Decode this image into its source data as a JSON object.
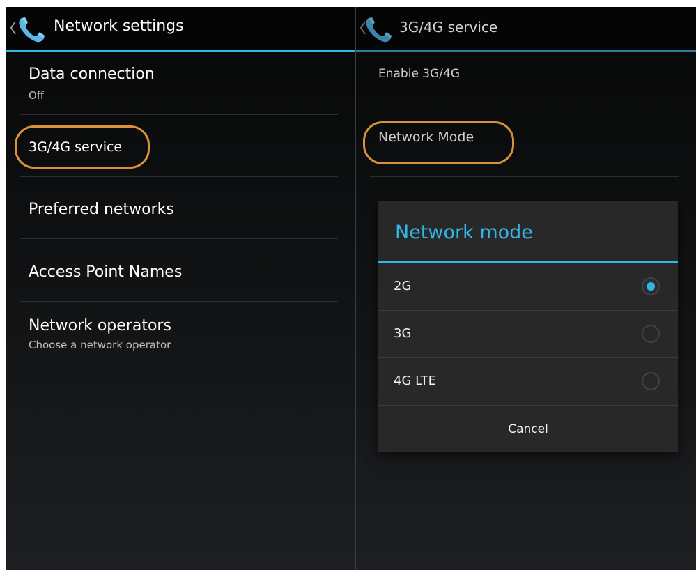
{
  "left": {
    "title": "Network settings",
    "items": [
      {
        "label": "Data connection",
        "sub": "Off"
      },
      {
        "label": "3G/4G service",
        "sub": ""
      },
      {
        "label": "Preferred networks",
        "sub": ""
      },
      {
        "label": "Access Point Names",
        "sub": ""
      },
      {
        "label": "Network operators",
        "sub": "Choose a network operator"
      }
    ]
  },
  "right": {
    "title": "3G/4G service",
    "items": [
      {
        "label": "Enable 3G/4G"
      },
      {
        "label": "Network Mode"
      }
    ]
  },
  "dialog": {
    "title": "Network mode",
    "options": [
      {
        "label": "2G",
        "selected": true
      },
      {
        "label": "3G",
        "selected": false
      },
      {
        "label": "4G LTE",
        "selected": false
      }
    ],
    "cancel": "Cancel"
  },
  "colors": {
    "accent": "#33b5e5",
    "highlight_ring": "#d9923a",
    "background": "#111214"
  },
  "icons": {
    "back": "chevron-left-icon",
    "app": "phone-icon"
  }
}
